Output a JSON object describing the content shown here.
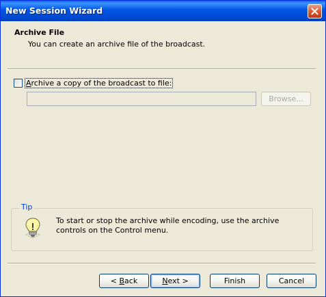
{
  "window": {
    "title": "New Session Wizard"
  },
  "header": {
    "title": "Archive File",
    "subtitle": "You can create an archive file of the broadcast."
  },
  "archive": {
    "checkbox_label_accel": "A",
    "checkbox_label_rest": "rchive a copy of the broadcast to file:",
    "checked": false,
    "file_path": "",
    "browse_label": "Browse..."
  },
  "tip": {
    "legend": "Tip",
    "text": "To start or stop the archive while encoding, use the archive controls on the Control menu.",
    "icon": "lightbulb-icon"
  },
  "buttons": {
    "back_accel": "<",
    "back_accel_char": "B",
    "back_rest": "ack",
    "next_accel": "N",
    "next_rest": "ext >",
    "finish": "Finish",
    "cancel": "Cancel"
  },
  "colors": {
    "titlebar": "#0054e3",
    "dialog_bg": "#ece9d8",
    "tip_legend": "#0046d5",
    "close_button": "#d6562e"
  }
}
